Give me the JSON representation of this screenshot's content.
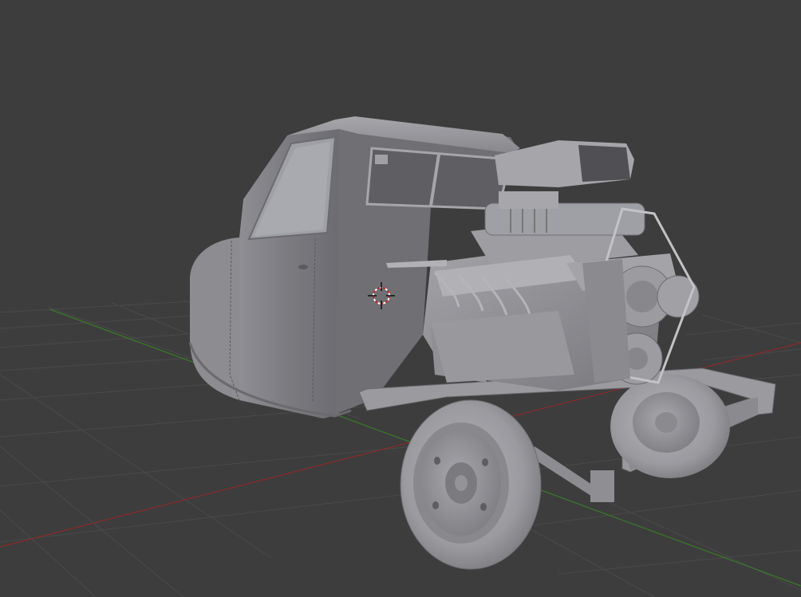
{
  "viewport": {
    "background_color": "#3d3d3d",
    "grid_color": "#4a4a4a",
    "x_axis_color": "#8a2a2a",
    "y_axis_color": "#3a7a2a",
    "model_color": "#8a8a8f",
    "cursor_colors": [
      "#cc2222",
      "#ffffff"
    ]
  },
  "scene": {
    "objects": [
      {
        "kind": "cab",
        "icon": "three-wheeler-cab"
      },
      {
        "kind": "engine",
        "icon": "v8-supercharged-engine"
      },
      {
        "kind": "chassis-frame",
        "icon": "chassis-frame"
      },
      {
        "kind": "front-wheel",
        "icon": "wheel"
      },
      {
        "kind": "rear-wheel",
        "icon": "wheel"
      }
    ],
    "cursor_icon": "3d-cursor-icon"
  }
}
